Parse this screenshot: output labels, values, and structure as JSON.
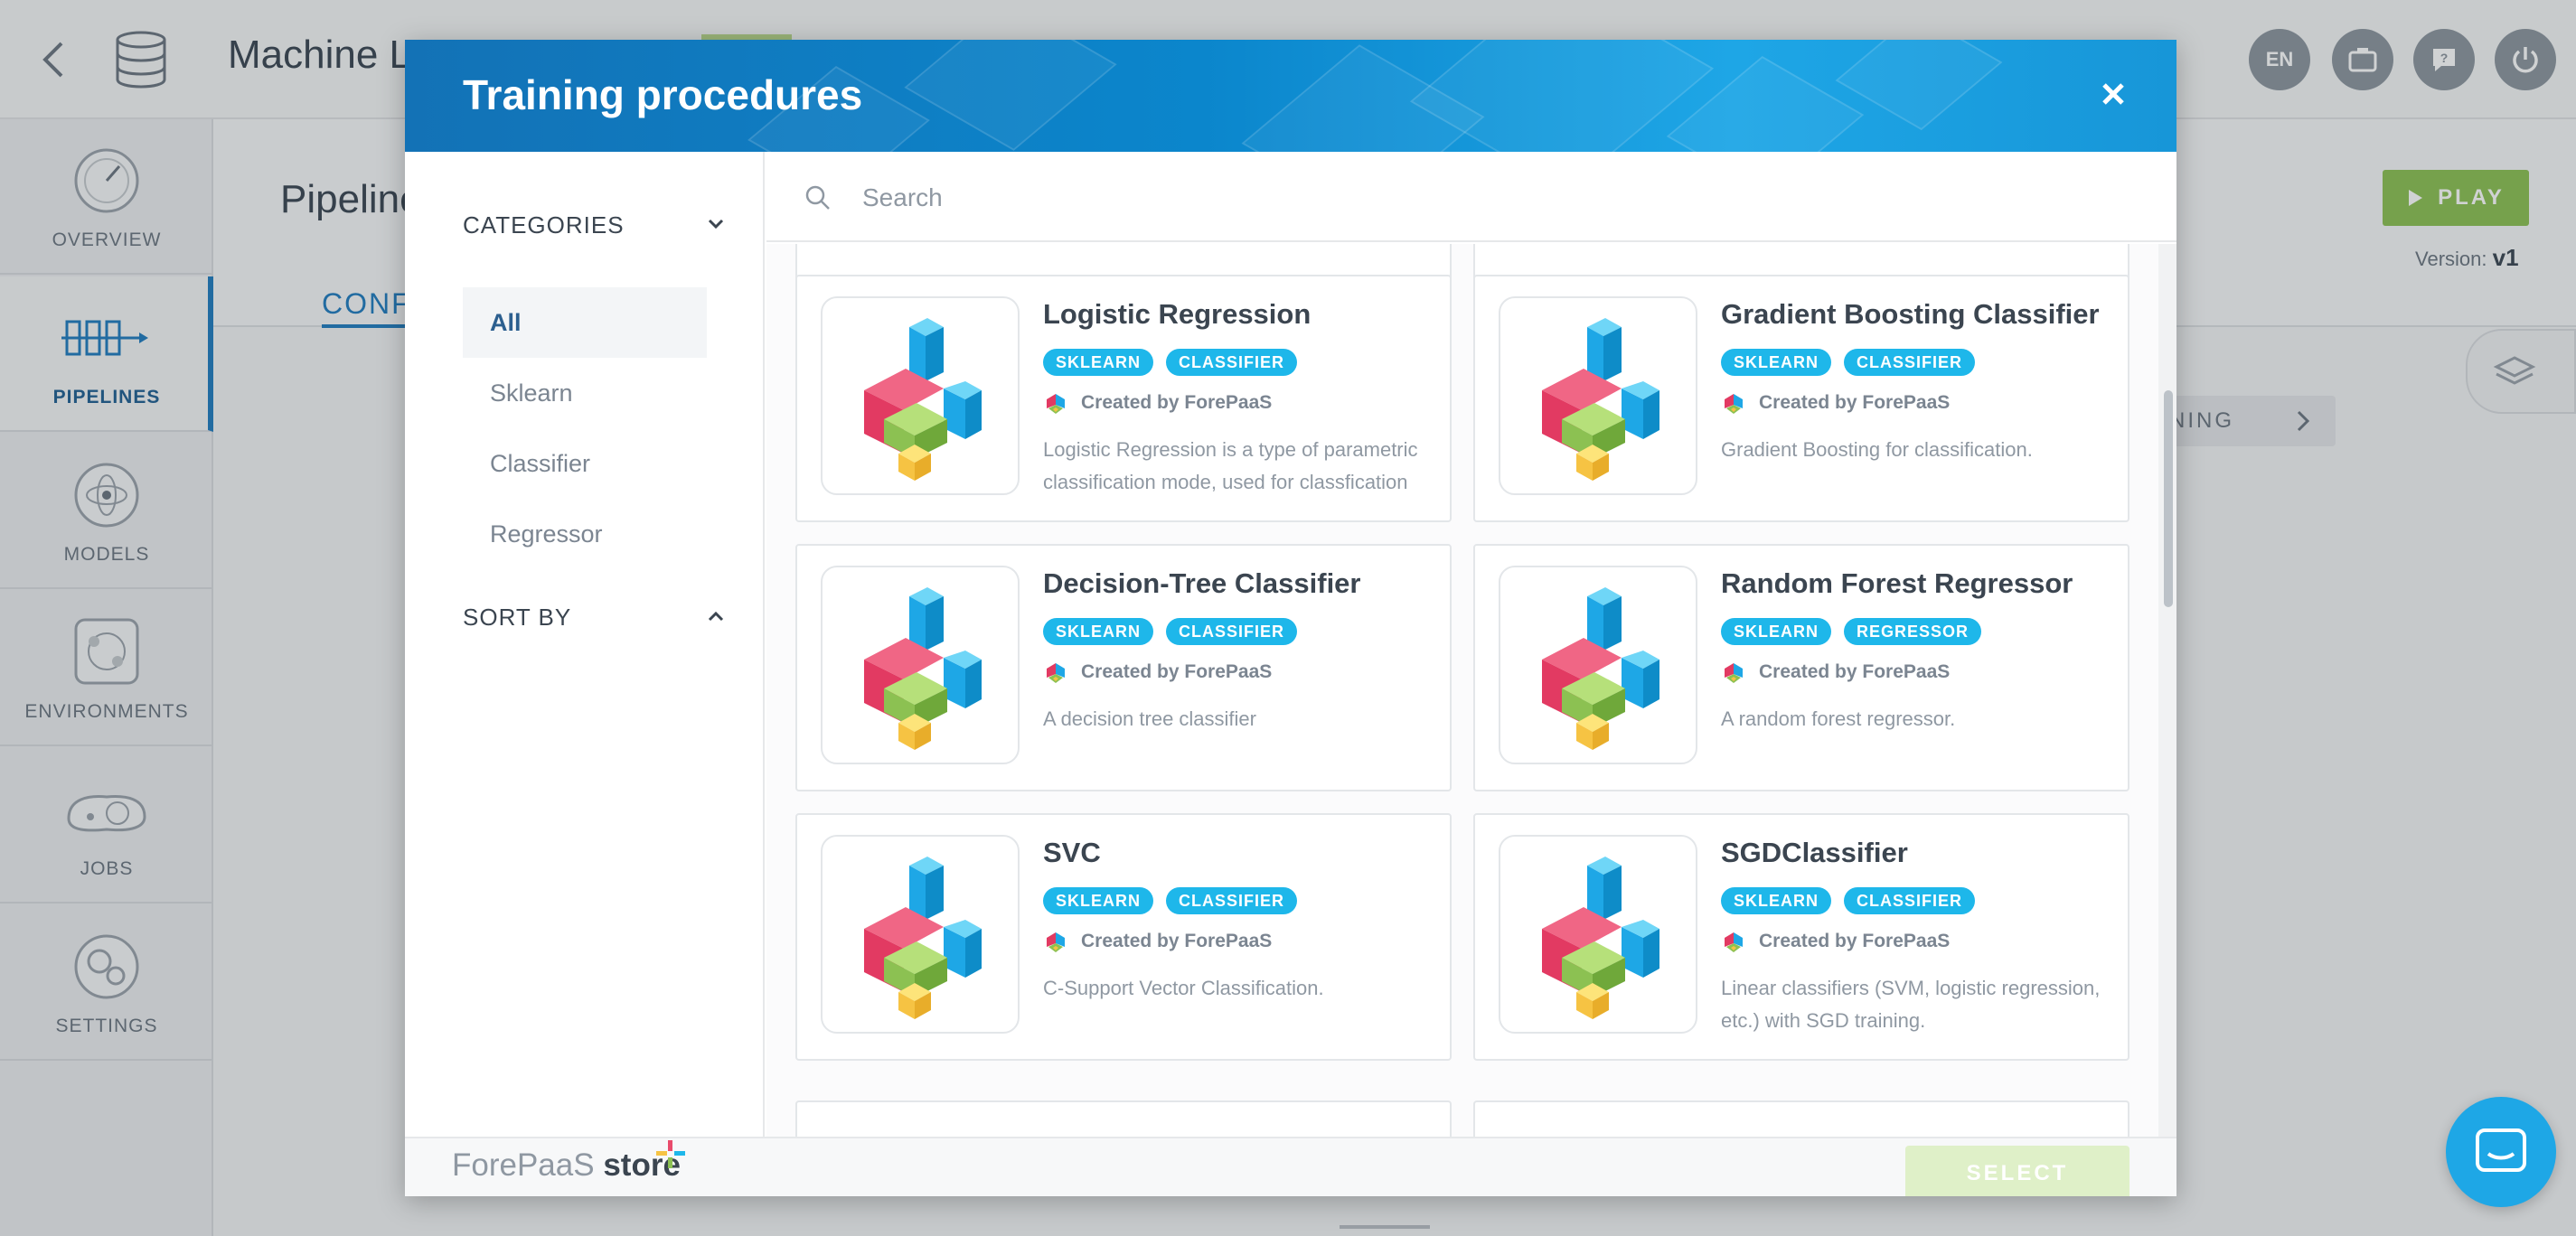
{
  "app": {
    "title": "Machine Le",
    "header_buttons": [
      {
        "label": "EN",
        "icon": "language-icon"
      },
      {
        "label": "",
        "icon": "app-switch-icon"
      },
      {
        "label": "",
        "icon": "help-icon"
      },
      {
        "label": "",
        "icon": "power-icon"
      }
    ]
  },
  "sidebar": {
    "items": [
      {
        "label": "OVERVIEW",
        "icon": "dashboard-icon",
        "active": false
      },
      {
        "label": "PIPELINES",
        "icon": "pipelines-icon",
        "active": true
      },
      {
        "label": "MODELS",
        "icon": "models-icon",
        "active": false
      },
      {
        "label": "ENVIRONMENTS",
        "icon": "environments-icon",
        "active": false
      },
      {
        "label": "JOBS",
        "icon": "jobs-icon",
        "active": false
      },
      {
        "label": "SETTINGS",
        "icon": "settings-icon",
        "active": false
      }
    ]
  },
  "page": {
    "title": "Pipeline",
    "tab": "CONFI",
    "play_label": "PLAY",
    "version_label": "Version:",
    "version_value": "v1",
    "running_label": "NING"
  },
  "modal": {
    "title": "Training procedures",
    "filters": {
      "categories_label": "CATEGORIES",
      "categories": [
        {
          "label": "All",
          "active": true
        },
        {
          "label": "Sklearn",
          "active": false
        },
        {
          "label": "Classifier",
          "active": false
        },
        {
          "label": "Regressor",
          "active": false
        }
      ],
      "sort_label": "SORT BY"
    },
    "search": {
      "placeholder": "Search",
      "value": ""
    },
    "cards": [
      {
        "title": "Logistic Regression",
        "tags": [
          "SKLEARN",
          "CLASSIFIER"
        ],
        "author": "Created by ForePaaS",
        "description": "Logistic Regression is a type of parametric classification mode, used for classfication"
      },
      {
        "title": "Gradient Boosting Classifier",
        "tags": [
          "SKLEARN",
          "CLASSIFIER"
        ],
        "author": "Created by ForePaaS",
        "description": "Gradient Boosting for classification."
      },
      {
        "title": "Decision-Tree Classifier",
        "tags": [
          "SKLEARN",
          "CLASSIFIER"
        ],
        "author": "Created by ForePaaS",
        "description": "A decision tree classifier"
      },
      {
        "title": "Random Forest Regressor",
        "tags": [
          "SKLEARN",
          "REGRESSOR"
        ],
        "author": "Created by ForePaaS",
        "description": "A random forest regressor."
      },
      {
        "title": "SVC",
        "tags": [
          "SKLEARN",
          "CLASSIFIER"
        ],
        "author": "Created by ForePaaS",
        "description": "C-Support Vector Classification."
      },
      {
        "title": "SGDClassifier",
        "tags": [
          "SKLEARN",
          "CLASSIFIER"
        ],
        "author": "Created by ForePaaS",
        "description": "Linear classifiers (SVM, logistic regression, etc.) with SGD training."
      }
    ],
    "footer": {
      "store_brand": "ForePaaS",
      "store_word": "store",
      "select_label": "SELECT"
    }
  },
  "colors": {
    "accent": "#1f7bbf",
    "tag": "#1eb7ea",
    "play": "#8cc152",
    "select_disabled": "#dff0c8"
  }
}
